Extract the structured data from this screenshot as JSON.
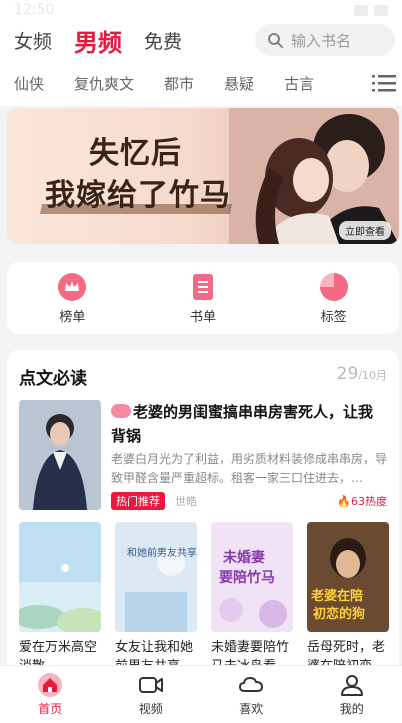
{
  "status_bar": {
    "time": "12:50"
  },
  "header": {
    "tabs": [
      {
        "label": "女频",
        "active": false
      },
      {
        "label": "男频",
        "active": true
      },
      {
        "label": "免费",
        "active": false
      }
    ],
    "search_placeholder": "输入书名"
  },
  "categories": [
    "仙侠",
    "复仇爽文",
    "都市",
    "悬疑",
    "古言"
  ],
  "banner": {
    "title_line1": "失忆后",
    "title_line2": "我嫁给了竹马",
    "button": "立即查看"
  },
  "quick_entries": [
    {
      "label": "榜单",
      "icon": "crown-icon"
    },
    {
      "label": "书单",
      "icon": "book-list-icon"
    },
    {
      "label": "标签",
      "icon": "tag-icon"
    }
  ],
  "recommend": {
    "title": "点文必读",
    "date_day": "29",
    "date_month": "/10月",
    "featured": {
      "title": "老婆的男闺蜜搞串串房害死人，让我背锅",
      "description": "老婆白月光为了利益，用劣质材料装修成串串房，导致甲醛含量严重超标。租客一家三口住进去，…",
      "tag": "热门推荐",
      "author": "世皓",
      "heat": "63热度"
    },
    "books": [
      {
        "title": "爱在万米高空消散"
      },
      {
        "title": "女友让我和她前男友共享"
      },
      {
        "title": "未婚妻要陪竹马去冰岛看"
      },
      {
        "title": "岳母死时，老婆在陪初恋"
      }
    ],
    "cover_texts": {
      "book2": "和她前男友共享婚房",
      "book3_line1": "未婚妻",
      "book3_line2": "要陪竹马",
      "book4_line1": "老婆在陪",
      "book4_line2": "初恋的狗"
    }
  },
  "bottom_nav": [
    {
      "label": "首页",
      "active": true
    },
    {
      "label": "视频",
      "active": false
    },
    {
      "label": "喜欢",
      "active": false
    },
    {
      "label": "我的",
      "active": false
    }
  ],
  "colors": {
    "accent": "#e8193d",
    "quick_icon": "#f26a84"
  }
}
